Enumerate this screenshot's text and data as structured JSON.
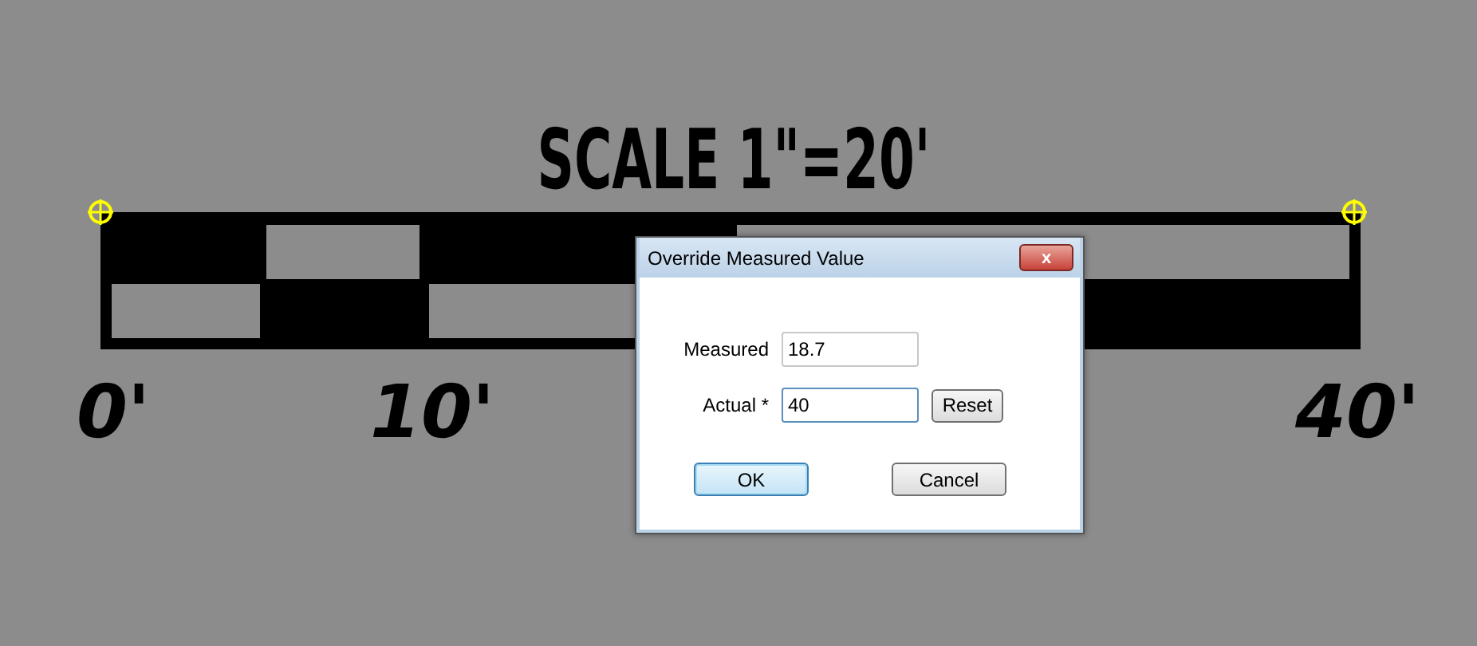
{
  "drawing": {
    "title": "SCALE 1\"=20'",
    "labels": [
      "0'",
      "10'",
      "40'"
    ]
  },
  "dialog": {
    "title": "Override Measured Value",
    "close": "x",
    "fields": [
      {
        "label": "Measured",
        "value": "18.7",
        "focused": false
      },
      {
        "label": "Actual *",
        "value": "40",
        "focused": true,
        "button": "Reset"
      }
    ],
    "buttons": [
      {
        "label": "OK",
        "default": true
      },
      {
        "label": "Cancel",
        "default": false
      }
    ]
  }
}
